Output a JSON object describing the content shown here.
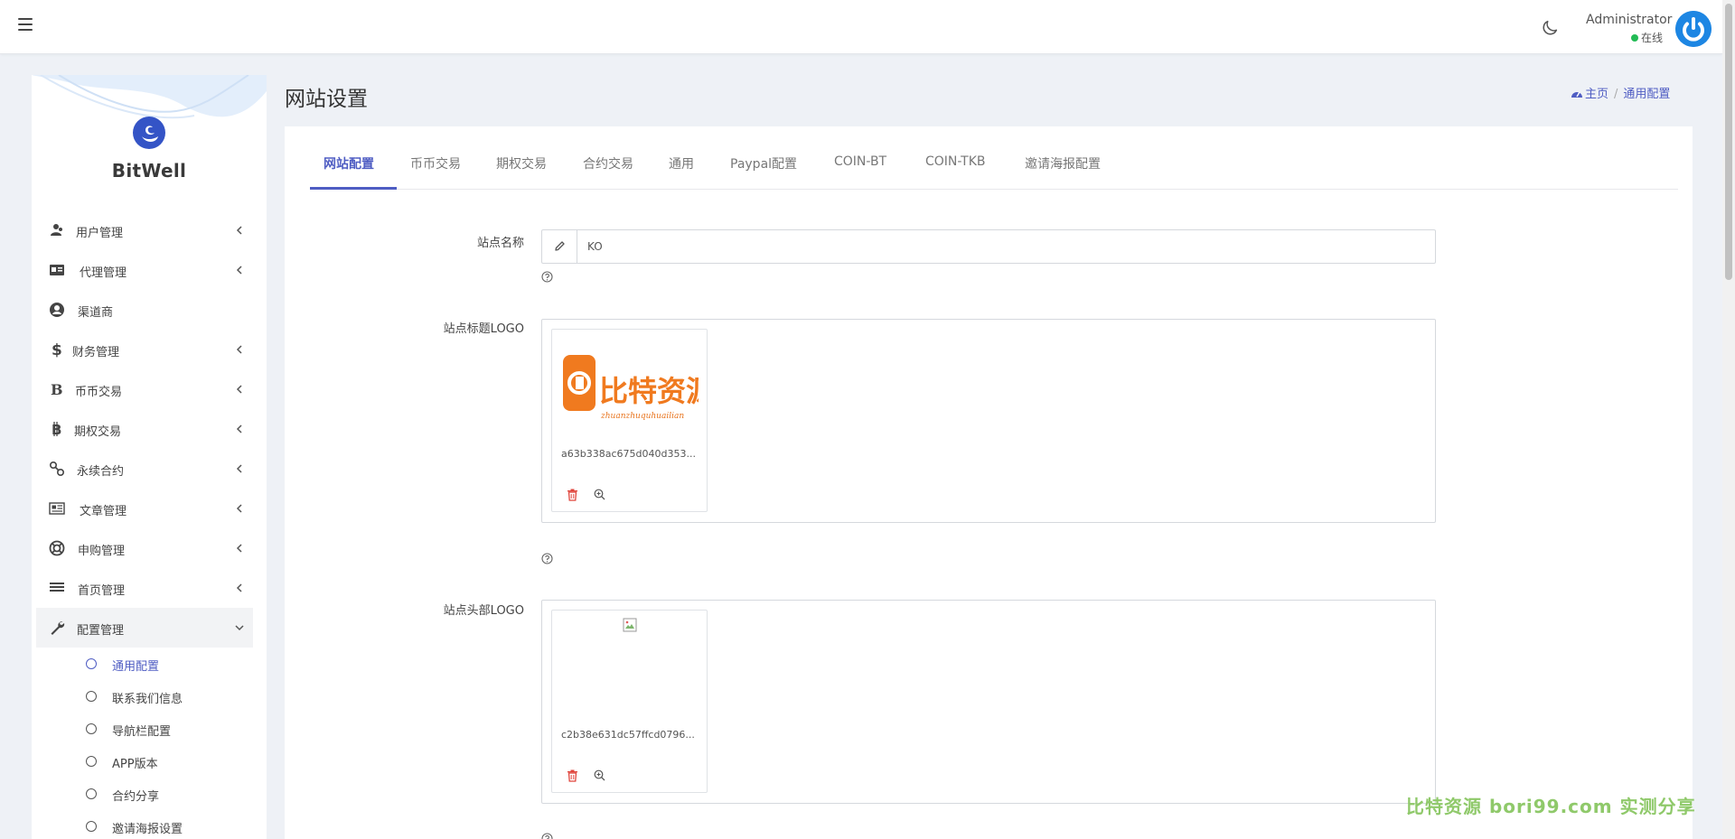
{
  "topbar": {
    "user_name": "Administrator",
    "user_status": "在线"
  },
  "brand": {
    "name": "BitWell"
  },
  "sidebar": {
    "items": [
      {
        "label": "用户管理",
        "icon": "users-icon"
      },
      {
        "label": "代理管理",
        "icon": "id-card-icon"
      },
      {
        "label": "渠道商",
        "icon": "user-circle-icon"
      },
      {
        "label": "财务管理",
        "icon": "dollar-icon"
      },
      {
        "label": "币币交易",
        "icon": "bold-b-icon"
      },
      {
        "label": "期权交易",
        "icon": "bitcoin-icon"
      },
      {
        "label": "永续合约",
        "icon": "link-icon"
      },
      {
        "label": "文章管理",
        "icon": "newspaper-icon"
      },
      {
        "label": "申购管理",
        "icon": "lifebuoy-icon"
      },
      {
        "label": "首页管理",
        "icon": "list-icon"
      },
      {
        "label": "配置管理",
        "icon": "wrench-icon"
      }
    ],
    "submenu": [
      {
        "label": "通用配置",
        "active": true
      },
      {
        "label": "联系我们信息"
      },
      {
        "label": "导航栏配置"
      },
      {
        "label": "APP版本"
      },
      {
        "label": "合约分享"
      },
      {
        "label": "邀请海报设置"
      }
    ]
  },
  "page": {
    "title": "网站设置",
    "breadcrumb_home": "主页",
    "breadcrumb_current": "通用配置"
  },
  "tabs": [
    {
      "label": "网站配置",
      "active": true
    },
    {
      "label": "币币交易"
    },
    {
      "label": "期权交易"
    },
    {
      "label": "合约交易"
    },
    {
      "label": "通用"
    },
    {
      "label": "Paypal配置"
    },
    {
      "label": "COIN-BT"
    },
    {
      "label": "COIN-TKB"
    },
    {
      "label": "邀请海报配置"
    }
  ],
  "form": {
    "site_name_label": "站点名称",
    "site_name_value": "KO",
    "title_logo_label": "站点标题LOGO",
    "title_logo_file": "a63b338ac675d040d353...",
    "title_logo_text_main": "比特资源",
    "title_logo_text_sub": "zhuanzhuquhuailian",
    "header_logo_label": "站点头部LOGO",
    "header_logo_file": "c2b38e631dc57ffcd0796..."
  },
  "watermark": "比特资源  bori99.com  实测分享",
  "colors": {
    "accent": "#4f5dc3",
    "logo_orange": "#f07a1f",
    "online_green": "#22bb55",
    "danger": "#e0443b"
  }
}
